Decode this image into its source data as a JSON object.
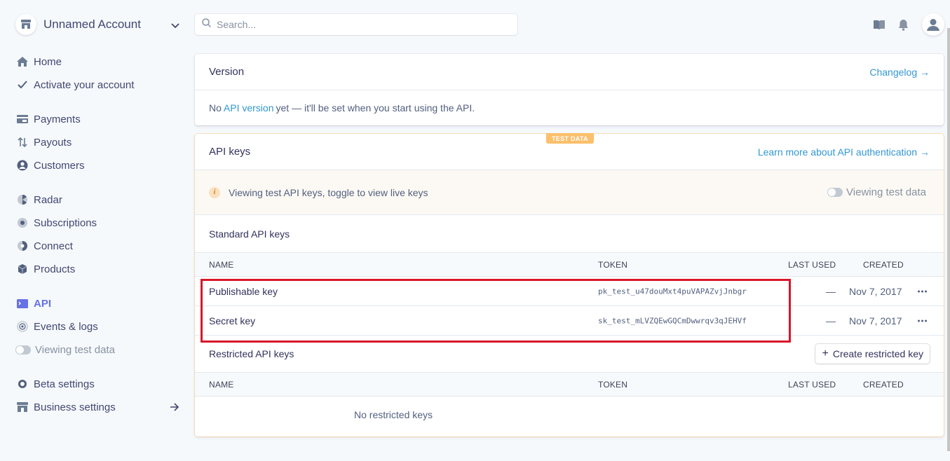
{
  "account": {
    "name": "Unnamed Account"
  },
  "search": {
    "placeholder": "Search..."
  },
  "sidebar": {
    "groups": [
      [
        {
          "label": "Home",
          "icon": "home-icon"
        },
        {
          "label": "Activate your account",
          "icon": "check-icon"
        }
      ],
      [
        {
          "label": "Payments",
          "icon": "payments-icon"
        },
        {
          "label": "Payouts",
          "icon": "payouts-icon"
        },
        {
          "label": "Customers",
          "icon": "customers-icon"
        }
      ],
      [
        {
          "label": "Radar",
          "icon": "radar-icon"
        },
        {
          "label": "Subscriptions",
          "icon": "subscriptions-icon"
        },
        {
          "label": "Connect",
          "icon": "connect-icon"
        },
        {
          "label": "Products",
          "icon": "products-icon"
        }
      ],
      [
        {
          "label": "API",
          "icon": "api-icon",
          "active": true
        },
        {
          "label": "Events & logs",
          "icon": "events-icon"
        },
        {
          "label": "Viewing test data",
          "icon": "toggle-icon"
        }
      ],
      [
        {
          "label": "Beta settings",
          "icon": "gear-icon"
        },
        {
          "label": "Business settings",
          "icon": "store-icon"
        }
      ]
    ],
    "home": "Home",
    "activate": "Activate your account",
    "payments": "Payments",
    "payouts": "Payouts",
    "customers": "Customers",
    "radar": "Radar",
    "subscriptions": "Subscriptions",
    "connect": "Connect",
    "products": "Products",
    "api": "API",
    "events": "Events & logs",
    "viewing_test": "Viewing test data",
    "beta": "Beta settings",
    "business": "Business settings"
  },
  "version_card": {
    "title": "Version",
    "changelog": "Changelog →",
    "body_prefix": "No ",
    "body_link": "API version",
    "body_suffix": " yet — it'll be set when you start using the API."
  },
  "api_card": {
    "badge": "TEST DATA",
    "title": "API keys",
    "learn_more": "Learn more about API authentication →",
    "notice": "Viewing test API keys, toggle to view live keys",
    "toggle_label": "Viewing test data",
    "standard_title": "Standard API keys",
    "columns": {
      "name": "NAME",
      "token": "TOKEN",
      "last_used": "LAST USED",
      "created": "CREATED"
    },
    "standard_keys": [
      {
        "name": "Publishable key",
        "token": "pk_test_u47douMxt4puVAPAZvjJnbgr",
        "last_used": "—",
        "created": "Nov 7, 2017"
      },
      {
        "name": "Secret key",
        "token": "sk_test_mLVZQEwGQCmDwwrqv3qJEHVf",
        "last_used": "—",
        "created": "Nov 7, 2017"
      }
    ],
    "restricted_title": "Restricted API keys",
    "create_restricted": "Create restricted key",
    "create_plus": "+",
    "no_restricted": "No restricted keys"
  },
  "colors": {
    "accent": "#6772e5",
    "link": "#3297d3",
    "badge": "#fcbf6b",
    "highlight": "#d9172b"
  }
}
